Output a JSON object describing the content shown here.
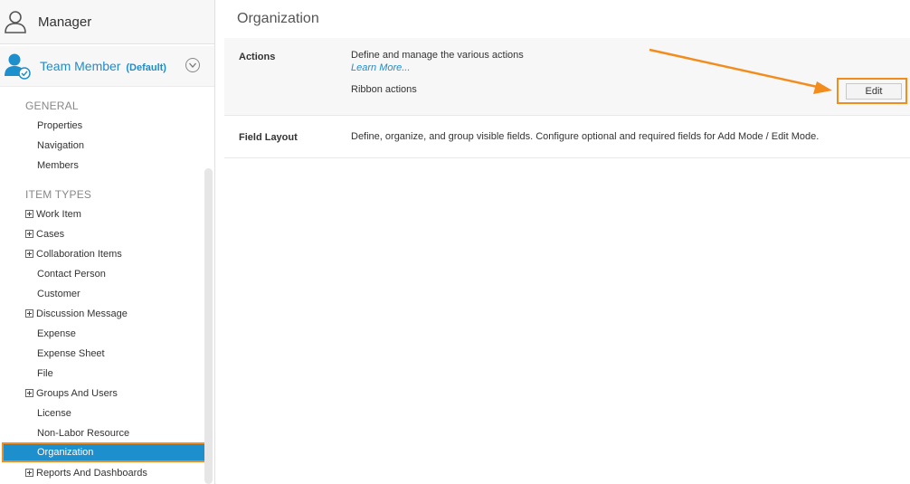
{
  "sidebar": {
    "roles": {
      "manager": {
        "label": "Manager"
      },
      "team_member": {
        "label": "Team Member",
        "default_tag": "(Default)"
      }
    },
    "general": {
      "heading": "GENERAL",
      "items": [
        "Properties",
        "Navigation",
        "Members"
      ]
    },
    "item_types": {
      "heading": "ITEM TYPES",
      "items": [
        {
          "label": "Work Item",
          "expandable": true
        },
        {
          "label": "Cases",
          "expandable": true
        },
        {
          "label": "Collaboration Items",
          "expandable": true
        },
        {
          "label": "Contact Person",
          "expandable": false
        },
        {
          "label": "Customer",
          "expandable": false
        },
        {
          "label": "Discussion Message",
          "expandable": true
        },
        {
          "label": "Expense",
          "expandable": false
        },
        {
          "label": "Expense Sheet",
          "expandable": false
        },
        {
          "label": "File",
          "expandable": false
        },
        {
          "label": "Groups And Users",
          "expandable": true
        },
        {
          "label": "License",
          "expandable": false
        },
        {
          "label": "Non-Labor Resource",
          "expandable": false
        },
        {
          "label": "Organization",
          "expandable": false,
          "selected": true
        },
        {
          "label": "Reports And Dashboards",
          "expandable": true
        }
      ]
    }
  },
  "main": {
    "title": "Organization",
    "rows": {
      "actions": {
        "name": "Actions",
        "description": "Define and manage the various actions",
        "learn_more": "Learn More...",
        "ribbon_label": "Ribbon actions",
        "edit_label": "Edit"
      },
      "field_layout": {
        "name": "Field Layout",
        "description": "Define, organize, and group visible fields. Configure optional and required fields for Add Mode / Edit Mode."
      }
    }
  },
  "colors": {
    "accent_blue": "#1d8fcc",
    "highlight_orange": "#f28c1c"
  }
}
